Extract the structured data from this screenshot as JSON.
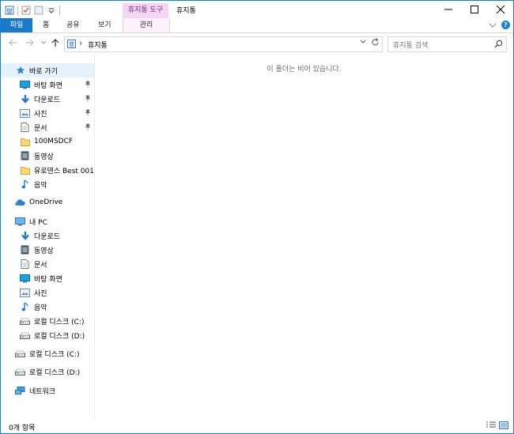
{
  "window": {
    "title": "휴지통",
    "context_tab_group": "휴지통 도구"
  },
  "ribbon": {
    "tabs": [
      {
        "label": "파일"
      },
      {
        "label": "홈"
      },
      {
        "label": "공유"
      },
      {
        "label": "보기"
      },
      {
        "label": "관리"
      }
    ]
  },
  "address": {
    "path": "휴지통",
    "search_placeholder": "휴지통 검색"
  },
  "sidebar": {
    "items": [
      {
        "label": "바로 가기",
        "icon": "star-icon"
      },
      {
        "label": "바탕 화면",
        "icon": "desktop-icon",
        "pinned": true
      },
      {
        "label": "다운로드",
        "icon": "download-icon",
        "pinned": true
      },
      {
        "label": "사진",
        "icon": "pictures-icon",
        "pinned": true
      },
      {
        "label": "문서",
        "icon": "documents-icon",
        "pinned": true
      },
      {
        "label": "100MSDCF",
        "icon": "folder-icon"
      },
      {
        "label": "동영상",
        "icon": "videos-icon"
      },
      {
        "label": "유로댄스 Best 001-",
        "icon": "folder-icon"
      },
      {
        "label": "음악",
        "icon": "music-icon"
      },
      {
        "label": "OneDrive",
        "icon": "onedrive-icon"
      },
      {
        "label": "내 PC",
        "icon": "pc-icon"
      },
      {
        "label": "다운로드",
        "icon": "download-icon"
      },
      {
        "label": "동영상",
        "icon": "videos-icon"
      },
      {
        "label": "문서",
        "icon": "documents-icon"
      },
      {
        "label": "바탕 화면",
        "icon": "desktop-icon"
      },
      {
        "label": "사진",
        "icon": "pictures-icon"
      },
      {
        "label": "음악",
        "icon": "music-icon"
      },
      {
        "label": "로컬 디스크 (C:)",
        "icon": "drive-icon"
      },
      {
        "label": "로컬 디스크 (D:)",
        "icon": "drive-icon"
      },
      {
        "label": "로컬 디스크 (C:)",
        "icon": "drive-icon"
      },
      {
        "label": "로컬 디스크 (D:)",
        "icon": "drive-icon"
      },
      {
        "label": "네트워크",
        "icon": "network-icon"
      }
    ]
  },
  "content": {
    "empty_message": "이 폴더는 비어 있습니다."
  },
  "status": {
    "item_count": "0개 항목"
  },
  "colors": {
    "accent": "#1979ca",
    "context_tab": "#f3d5f4",
    "selection": "#e5f1fb"
  }
}
